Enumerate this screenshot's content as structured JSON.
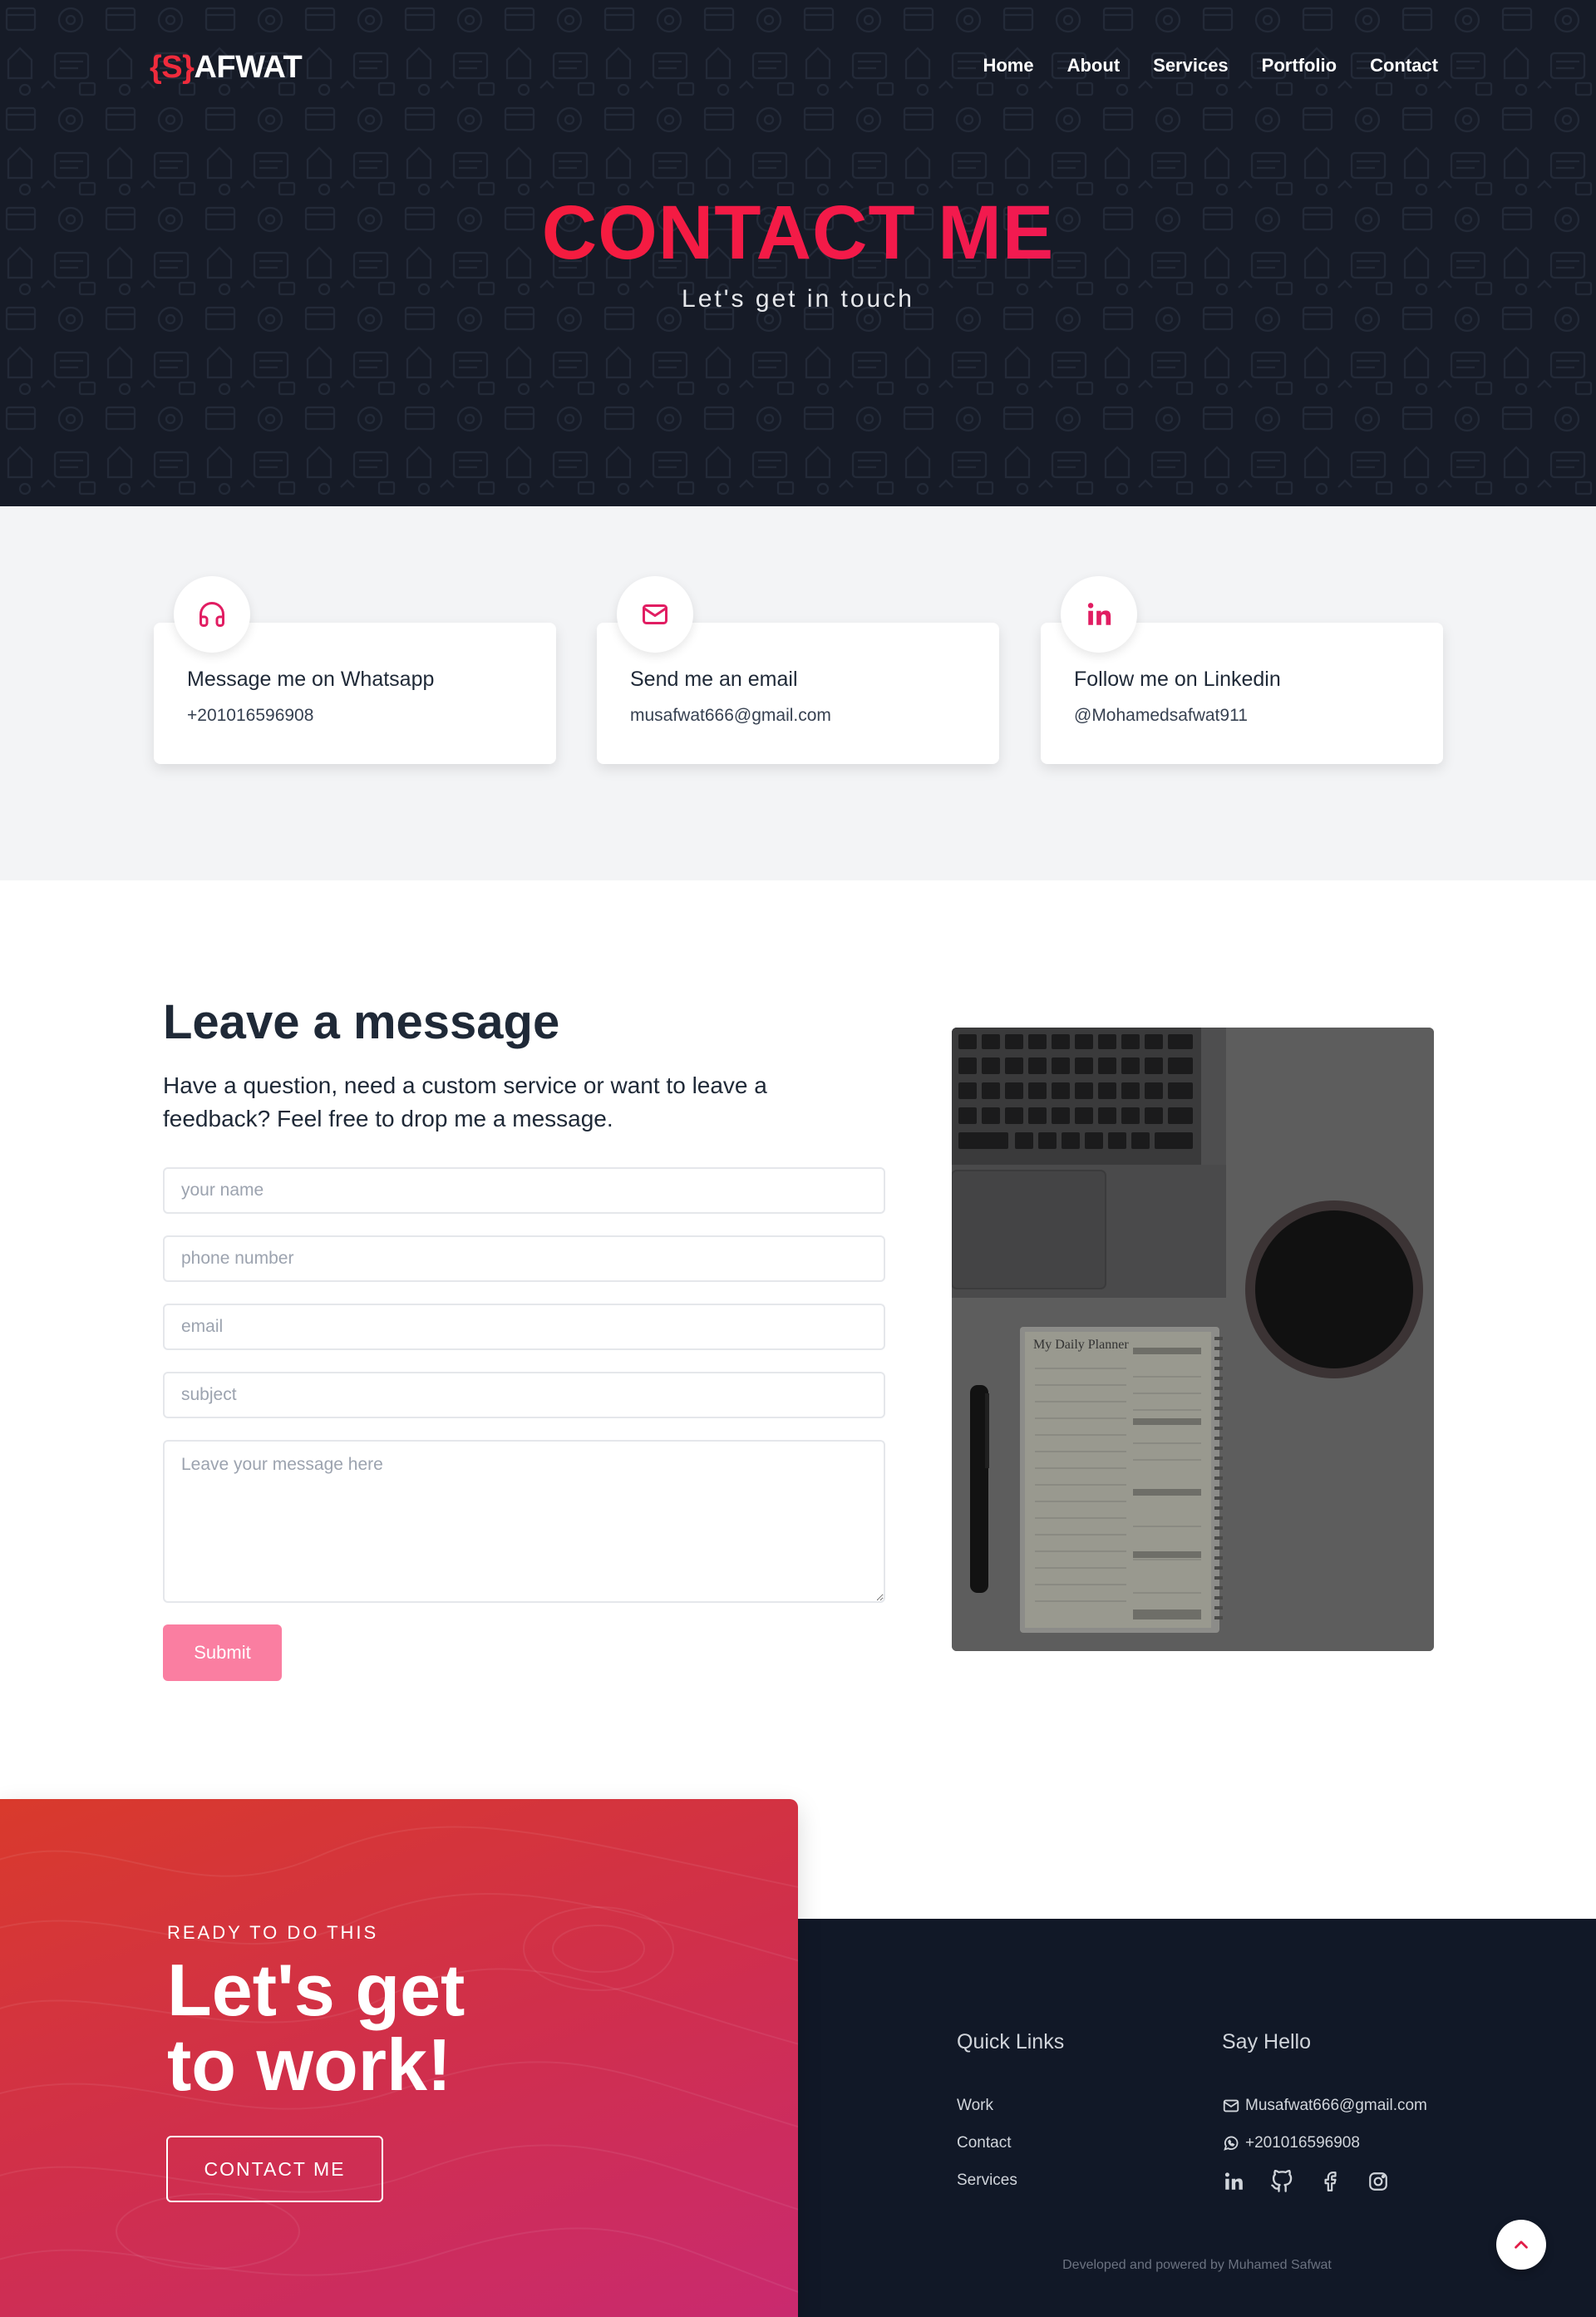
{
  "brand": {
    "logo_accent": "{S}",
    "logo_text": "AFWAT"
  },
  "nav": {
    "items": [
      "Home",
      "About",
      "Services",
      "Portfolio",
      "Contact"
    ]
  },
  "hero": {
    "title": "CONTACT ME",
    "subtitle": "Let's get in touch"
  },
  "contact_cards": [
    {
      "icon": "headphones-icon",
      "title": "Message me on Whatsapp",
      "text": "+201016596908"
    },
    {
      "icon": "mail-icon",
      "title": "Send me an email",
      "text": "musafwat666@gmail.com"
    },
    {
      "icon": "linkedin-icon",
      "title": "Follow me on Linkedin",
      "text": "@Mohamedsafwat911"
    }
  ],
  "message_section": {
    "title": "Leave a message",
    "description": "Have a question, need a custom service or want to leave a feedback? Feel free to drop me a message.",
    "fields": {
      "name_placeholder": "your name",
      "phone_placeholder": "phone number",
      "email_placeholder": "email",
      "subject_placeholder": "subject",
      "message_placeholder": "Leave your message here"
    },
    "submit_label": "Submit",
    "planner_title": "My Daily Planner"
  },
  "cta": {
    "eyebrow": "READY TO DO THIS",
    "title_line1": "Let's get",
    "title_line2": "to work!",
    "button_label": "CONTACT ME"
  },
  "footer": {
    "quick_links_title": "Quick Links",
    "quick_links": [
      "Work",
      "Contact",
      "Services"
    ],
    "say_hello_title": "Say Hello",
    "email": "Musafwat666@gmail.com",
    "phone": "+201016596908",
    "socials": [
      "linkedin-icon",
      "github-icon",
      "facebook-icon",
      "instagram-icon"
    ],
    "credit": "Developed and powered by Muhamed Safwat"
  },
  "colors": {
    "accent": "#ef2b3c",
    "pink": "#e11d62",
    "hero_bg": "#161b27",
    "footer_bg": "#111827",
    "submit_bg": "#fa7ea1",
    "cta_gradient": [
      "#d93a2c",
      "#c92a6f"
    ]
  }
}
